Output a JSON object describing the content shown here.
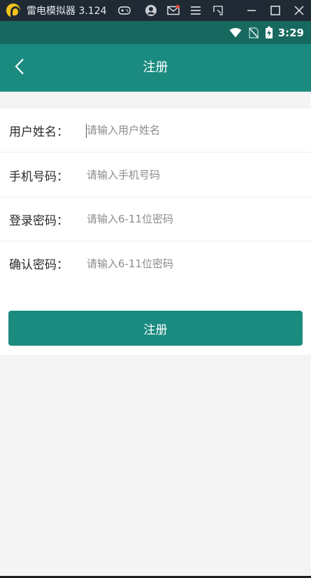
{
  "emulator": {
    "title": "雷电模拟器 3.124",
    "icons": [
      "gamepad-icon",
      "user-icon",
      "mail-icon",
      "menu-icon",
      "resize-icon"
    ],
    "window_controls": [
      "minimize-icon",
      "maximize-icon",
      "close-icon"
    ]
  },
  "status_bar": {
    "time": "3:29",
    "icons": [
      "wifi-icon",
      "no-sim-icon",
      "battery-charging-icon"
    ]
  },
  "app_bar": {
    "back_icon": "chevron-left-icon",
    "title": "注册"
  },
  "form": {
    "fields": [
      {
        "label": "用户姓名：",
        "placeholder": "请输入用户姓名",
        "value": ""
      },
      {
        "label": "手机号码：",
        "placeholder": "请输入手机号码",
        "value": ""
      },
      {
        "label": "登录密码：",
        "placeholder": "请输入6-11位密码",
        "value": ""
      },
      {
        "label": "确认密码：",
        "placeholder": "请输入6-11位密码",
        "value": ""
      }
    ],
    "submit_label": "注册"
  },
  "colors": {
    "primary": "#1b8b80",
    "status_bar": "#17695f",
    "emulator_bar": "#202a34",
    "background": "#f4f4f4"
  }
}
